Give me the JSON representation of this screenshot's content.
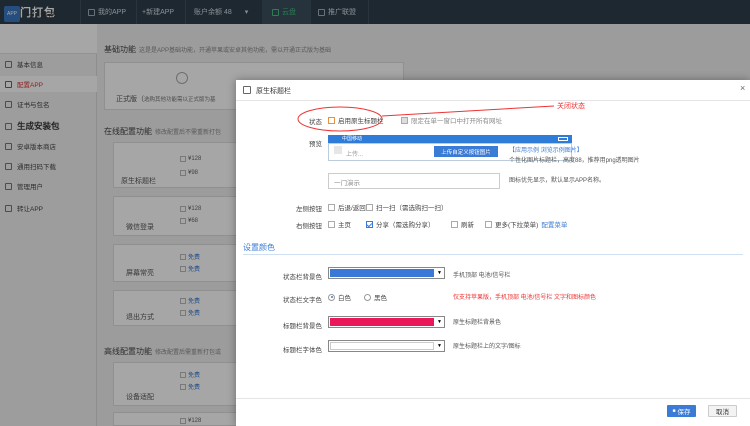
{
  "topbar": {
    "logo": "一门打包",
    "my_app": "我的APP",
    "new_app": "+新建APP",
    "balance": "账户余额 48",
    "balance_arrow": "▾",
    "green": "云盘",
    "alliance": "推广联盟"
  },
  "sidebar": {
    "app_icon_text": "APP",
    "app_name": "一门演示",
    "items": [
      {
        "label": "基本信息"
      },
      {
        "label": "配置APP"
      },
      {
        "label": "证书与包名"
      },
      {
        "label": "生成安装包"
      },
      {
        "label": "安卓版本商店"
      },
      {
        "label": "通用扫码下载"
      },
      {
        "label": "管理用户"
      },
      {
        "label": "转让APP"
      }
    ]
  },
  "main": {
    "basic_title": "基础功能",
    "basic_desc": "这是是APP基础功能，开通苹果或安卓其他功能，需以开通正式版为基础",
    "formal_label": "正式版（",
    "formal_desc": "选购其他功能需以正式版为基",
    "online_title": "在线配置功能",
    "online_desc": "修改配置后不需重新打包",
    "cards": [
      {
        "name": "原生标题栏",
        "p1": "¥128",
        "p2": "¥98"
      },
      {
        "name": "微信登录",
        "p1": "¥128",
        "p2": "¥68"
      },
      {
        "name": "屏幕常亮",
        "p1": "免费",
        "p2": "免费"
      },
      {
        "name": "退出方式",
        "p1": "免费",
        "p2": "免费"
      }
    ],
    "offline_title": "高线配置功能",
    "offline_desc": "修改配置后需重新打包或",
    "cards2": [
      {
        "name": "设备适配",
        "p1": "免费",
        "p2": "免费"
      },
      {
        "name": "",
        "p1": "¥128",
        "p2": ""
      }
    ]
  },
  "dialog": {
    "title": "原生标题栏",
    "annotation": "关闭状态",
    "status_label": "状态",
    "enable_native": "启用原生标题栏",
    "limit_window": "限定在单一窗口中打开所有网址",
    "preview_label": "预览",
    "preview_carrier": "中国移动",
    "upload_placeholder": "上传...",
    "upload_button": "上传自定义按钮图片",
    "example_link": "【应用示例",
    "browse_link": "浏览示例图片】",
    "upload_hint": "个性化图片标题栏，高度88，推荐用png透明图片",
    "title_input_placeholder": "一门演示",
    "title_hint": "图标优先显示，默认显示APP名称。",
    "left_btn_label": "左侧按钮",
    "left_opts": [
      "后退/返回",
      "扫一扫（需选购扫一扫）"
    ],
    "right_btn_label": "右侧按钮",
    "right_opts": [
      "主页",
      "分享（需选购分享）",
      "刷新",
      "更多(下拉菜单)"
    ],
    "config_menu": "配置菜单",
    "color_section": "设置颜色",
    "status_bg_label": "状态栏背景色",
    "status_bg_color": "#3a78d8",
    "status_bg_hint": "手机顶部 电池/信号栏",
    "status_text_label": "状态栏文字色",
    "status_text_opts": [
      "白色",
      "黑色"
    ],
    "status_text_hint": "仅支持苹果版，手机顶部 电池/信号栏 文字和图标颜色",
    "title_bg_label": "标题栏背景色",
    "title_bg_color": "#e8185a",
    "title_bg_hint": "原生标题栏背景色",
    "title_text_label": "标题栏字体色",
    "title_text_color": "#ffffff",
    "title_text_hint": "原生标题栏上的文字/图标",
    "save": "保存",
    "cancel": "取消"
  }
}
